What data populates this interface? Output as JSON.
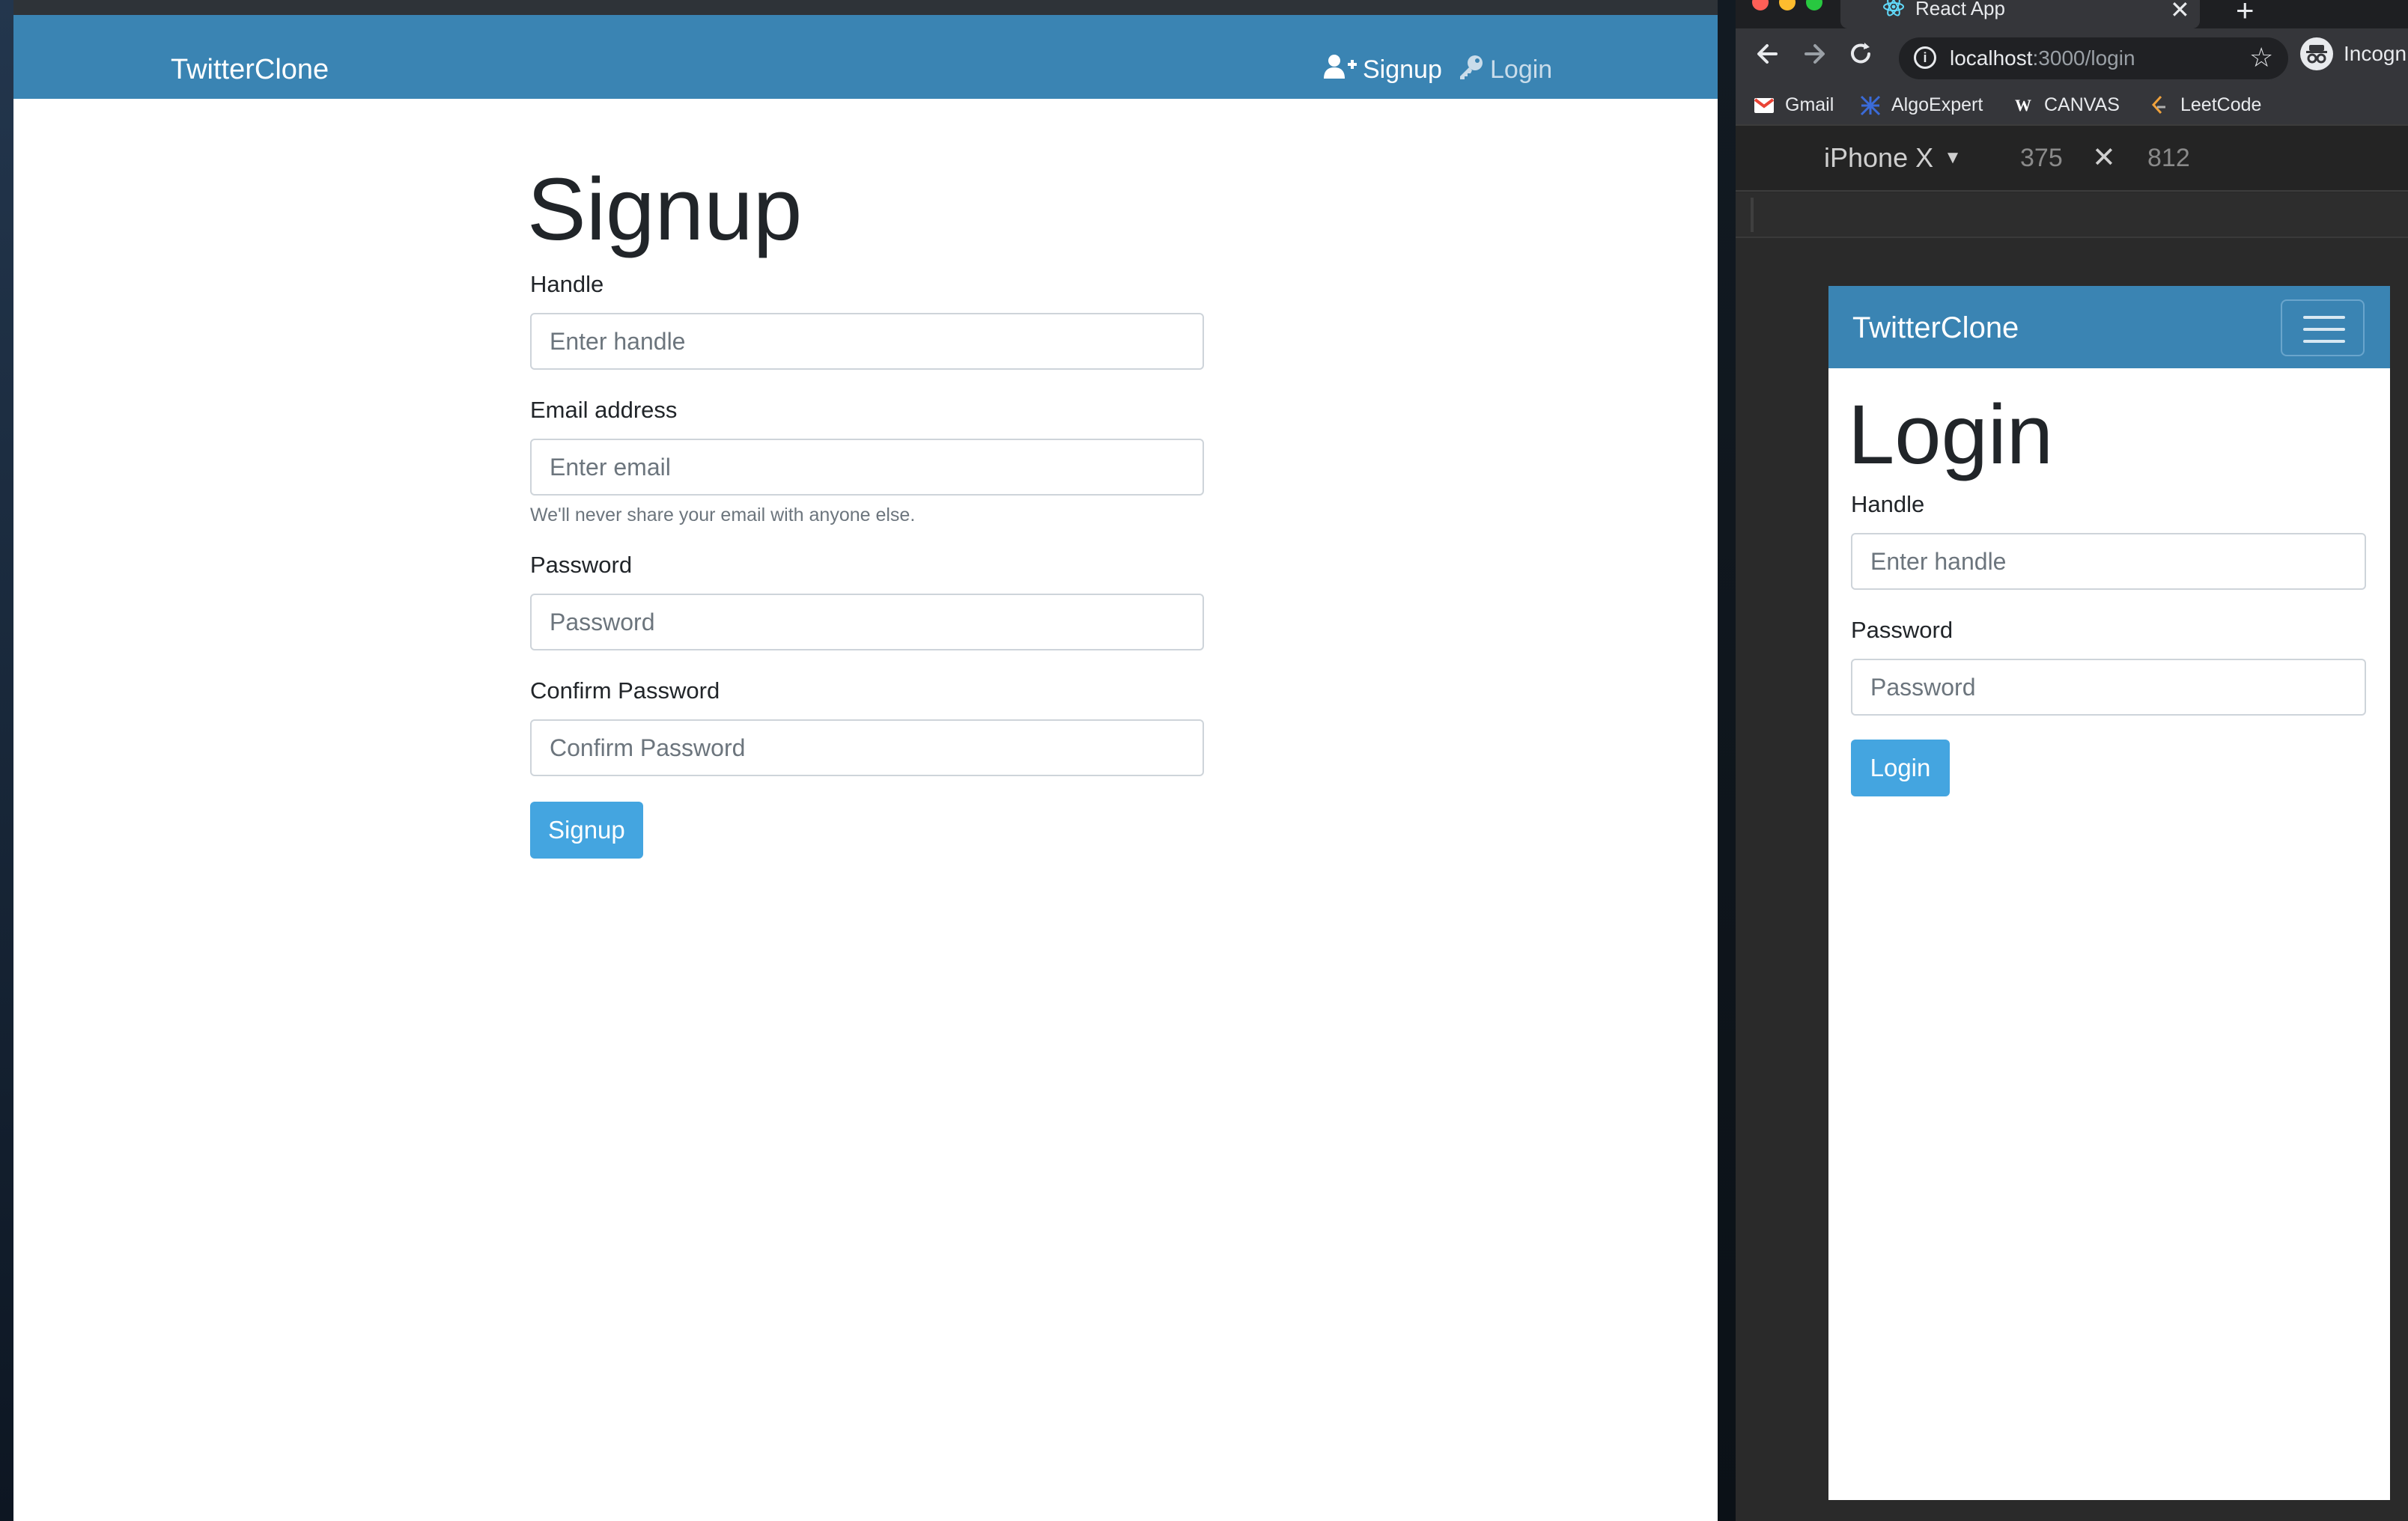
{
  "left_app": {
    "brand": "TwitterClone",
    "nav": {
      "signup": "Signup",
      "login": "Login"
    },
    "page_title": "Signup",
    "fields": {
      "handle": {
        "label": "Handle",
        "placeholder": "Enter handle"
      },
      "email": {
        "label": "Email address",
        "placeholder": "Enter email",
        "help": "We'll never share your email with anyone else."
      },
      "password": {
        "label": "Password",
        "placeholder": "Password"
      },
      "confirm": {
        "label": "Confirm Password",
        "placeholder": "Confirm Password"
      }
    },
    "submit": "Signup"
  },
  "chrome": {
    "tab_title": "React App",
    "url_host": "localhost",
    "url_path": ":3000/login",
    "profile": "Incognito",
    "bookmarks": [
      "Gmail",
      "AlgoExpert",
      "CANVAS",
      "LeetCode"
    ],
    "device": {
      "name": "iPhone X",
      "width": "375",
      "height": "812"
    }
  },
  "mobile_app": {
    "brand": "TwitterClone",
    "page_title": "Login",
    "fields": {
      "handle": {
        "label": "Handle",
        "placeholder": "Enter handle"
      },
      "password": {
        "label": "Password",
        "placeholder": "Password"
      }
    },
    "submit": "Login"
  },
  "colors": {
    "navbar": "#3a84b3",
    "primary_button": "#44a5e0"
  }
}
